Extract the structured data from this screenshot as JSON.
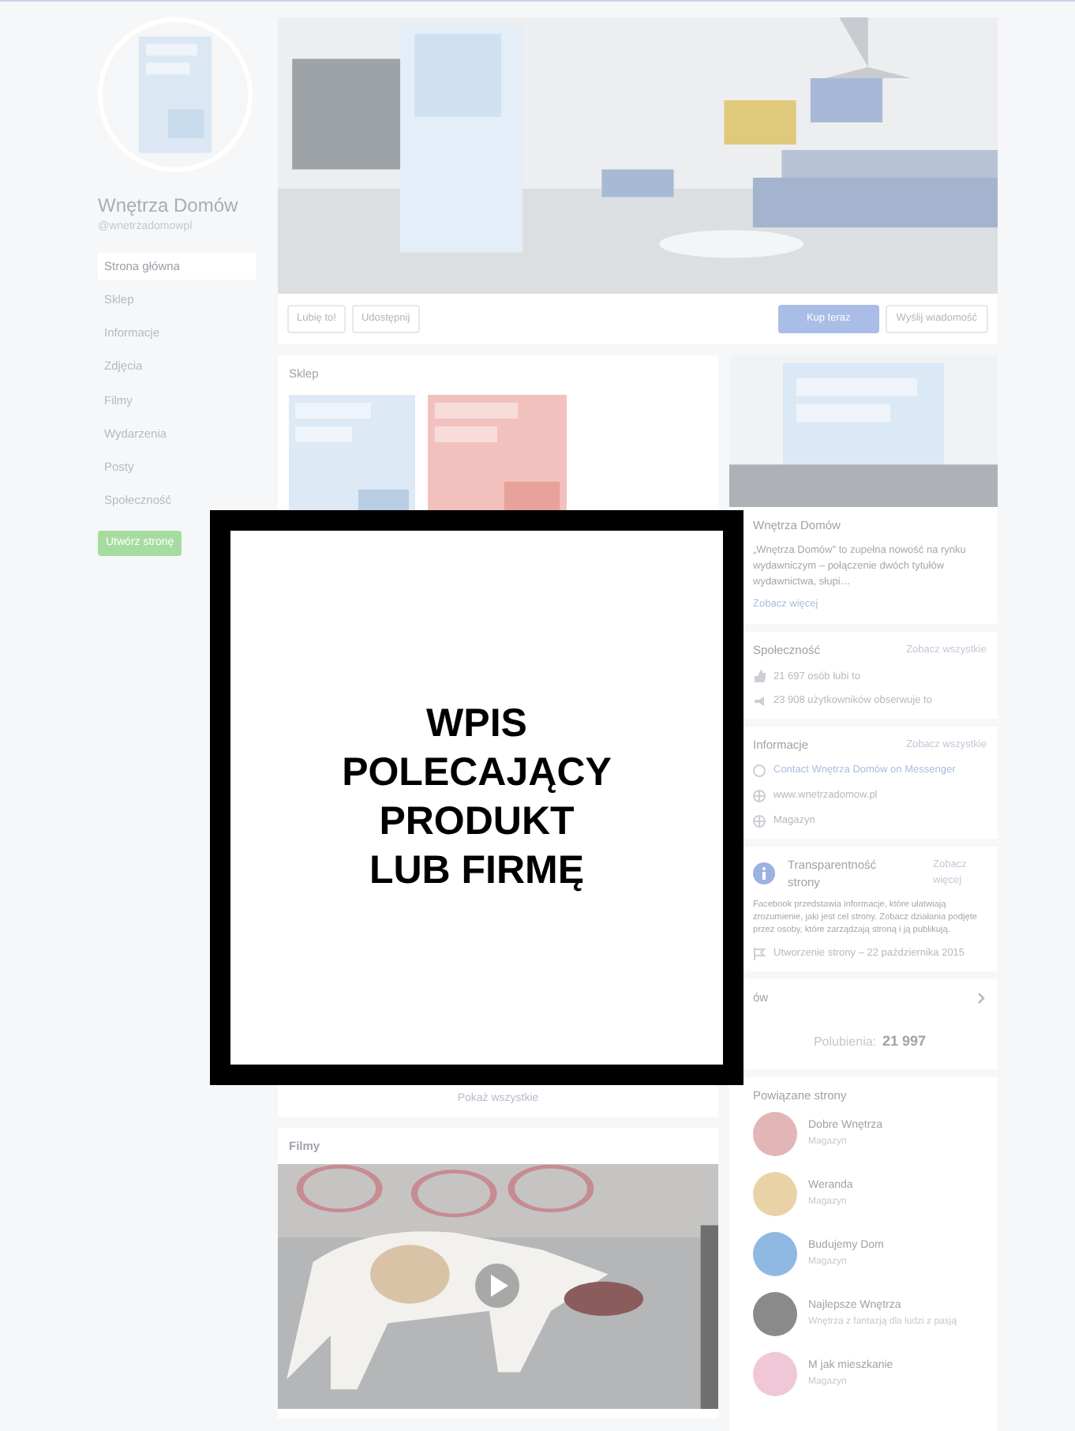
{
  "page": {
    "name": "Wnętrza Domów",
    "handle": "@wnetrzadomowpl"
  },
  "sidebar": {
    "items": [
      {
        "label": "Strona główna",
        "selected": true
      },
      {
        "label": "Sklep",
        "selected": false
      },
      {
        "label": "Informacje",
        "selected": false
      },
      {
        "label": "Zdjęcia",
        "selected": false
      },
      {
        "label": "Filmy",
        "selected": false
      },
      {
        "label": "Wydarzenia",
        "selected": false
      },
      {
        "label": "Posty",
        "selected": false
      },
      {
        "label": "Społeczność",
        "selected": false
      }
    ],
    "create_button": "Utwórz stronę"
  },
  "actions": {
    "left": [
      "Lubię to!",
      "Udostępnij"
    ],
    "primary": "Kup teraz",
    "message": "Wyślij wiadomość"
  },
  "shop": {
    "title": "Sklep",
    "show_all": "Pokaż wszystkie"
  },
  "videos": {
    "title": "Filmy"
  },
  "about": {
    "title": "Wnętrza Domów",
    "text": "„Wnętrza Domów\" to zupełna nowość na rynku wydawniczym – połączenie dwóch tytułów wydawnictwa, słupi…",
    "more": "Zobacz więcej"
  },
  "community": {
    "title": "Społeczność",
    "see_all": "Zobacz wszystkie",
    "rows": [
      "21 697 osób lubi to",
      "23 908 użytkowników obserwuje to"
    ]
  },
  "info": {
    "title": "Informacje",
    "see_all": "Zobacz wszystkie",
    "rows": [
      {
        "text": "Contact Wnętrza Domów on Messenger",
        "kind": "link"
      },
      {
        "text": "www.wnetrzadomow.pl",
        "kind": "plain"
      },
      {
        "text": "Magazyn",
        "kind": "plain"
      }
    ]
  },
  "transparency": {
    "title": "Transparentność strony",
    "see_more": "Zobacz więcej",
    "text": "Facebook przedstawia informacje, które ułatwiają zrozumienie, jaki jest cel strony. Zobacz działania podjęte przez osoby, które zarządzają stroną i ją publikują.",
    "created": "Utworzenie strony – 22 października 2015"
  },
  "likes": {
    "title": "ów",
    "count_label": "Polubienia:",
    "count": "21 997"
  },
  "related": {
    "title": "Powiązane strony",
    "pages": [
      {
        "name": "Dobre Wnętrza",
        "sub": "Magazyn",
        "color": "#e2b6b6"
      },
      {
        "name": "Weranda",
        "sub": "Magazyn",
        "color": "#e9d3a6"
      },
      {
        "name": "Budujemy Dom",
        "sub": "Magazyn",
        "color": "#8fb9e3"
      },
      {
        "name": "Najlepsze Wnętrza",
        "sub": "Wnętrza z fantazją dla ludzi z pasją",
        "color": "#8a8a8a"
      },
      {
        "name": "M jak mieszkanie",
        "sub": "Magazyn",
        "color": "#f0c7d6"
      }
    ]
  },
  "overlay": {
    "lines": [
      "WPIS",
      "POLECAJĄCY",
      "PRODUKT",
      "LUB FIRMĘ"
    ]
  }
}
